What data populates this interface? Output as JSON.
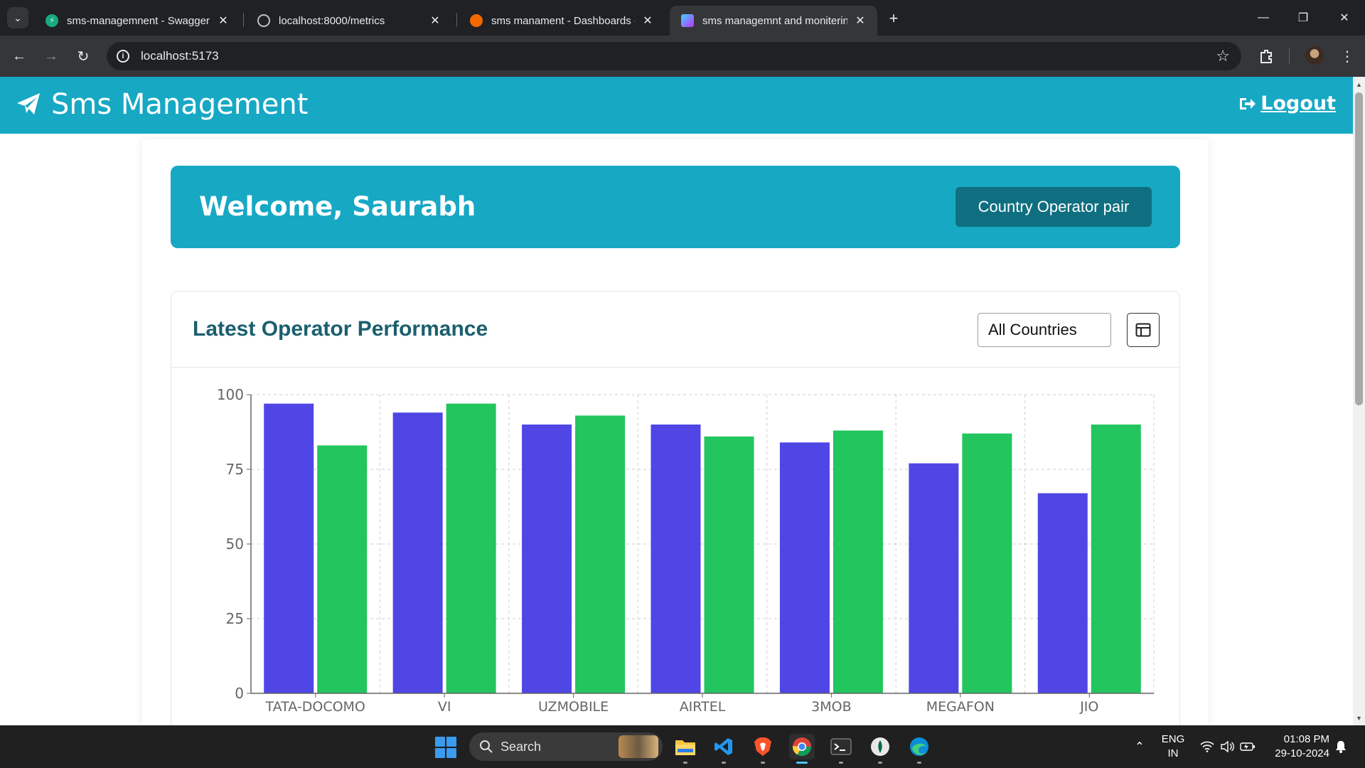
{
  "browser": {
    "tabs": [
      {
        "title": "sms-managemnent - Swagger UI",
        "icon_color": "#1aa882",
        "icon_letter": "⚡"
      },
      {
        "title": "localhost:8000/metrics",
        "icon_color": "#5f6368",
        "icon_letter": "◍"
      },
      {
        "title": "sms manament - Dashboards - Grafana",
        "icon_color": "#f46800",
        "icon_letter": "◉"
      },
      {
        "title": "sms managemnt and monitering",
        "icon_color": "#8c5cf6",
        "icon_letter": "▼"
      }
    ],
    "url": "localhost:5173"
  },
  "app": {
    "brand": "Sms Management",
    "logout_label": "Logout",
    "welcome": "Welcome, Saurabh",
    "country_operator_button": "Country Operator pair",
    "card_title": "Latest Operator Performance",
    "country_filter": "All Countries"
  },
  "colors": {
    "primary": "#17a8c4",
    "dark_button": "#0f6f80",
    "series_1": "#4f46e5",
    "series_2": "#22c55e"
  },
  "chart_data": {
    "type": "bar",
    "categories": [
      "TATA-DOCOMO",
      "VI",
      "UZMOBILE",
      "AIRTEL",
      "3MOB",
      "MEGAFON",
      "JIO"
    ],
    "series": [
      {
        "values": [
          97,
          94,
          90,
          90,
          84,
          77,
          67
        ]
      },
      {
        "values": [
          83,
          97,
          93,
          86,
          88,
          87,
          90
        ]
      }
    ],
    "yticks": [
      0,
      25,
      50,
      75,
      100
    ],
    "ylim": [
      0,
      100
    ],
    "grid": true
  },
  "taskbar": {
    "search_label": "Search",
    "lang_top": "ENG",
    "lang_bottom": "IN",
    "time": "01:08 PM",
    "date": "29-10-2024"
  }
}
